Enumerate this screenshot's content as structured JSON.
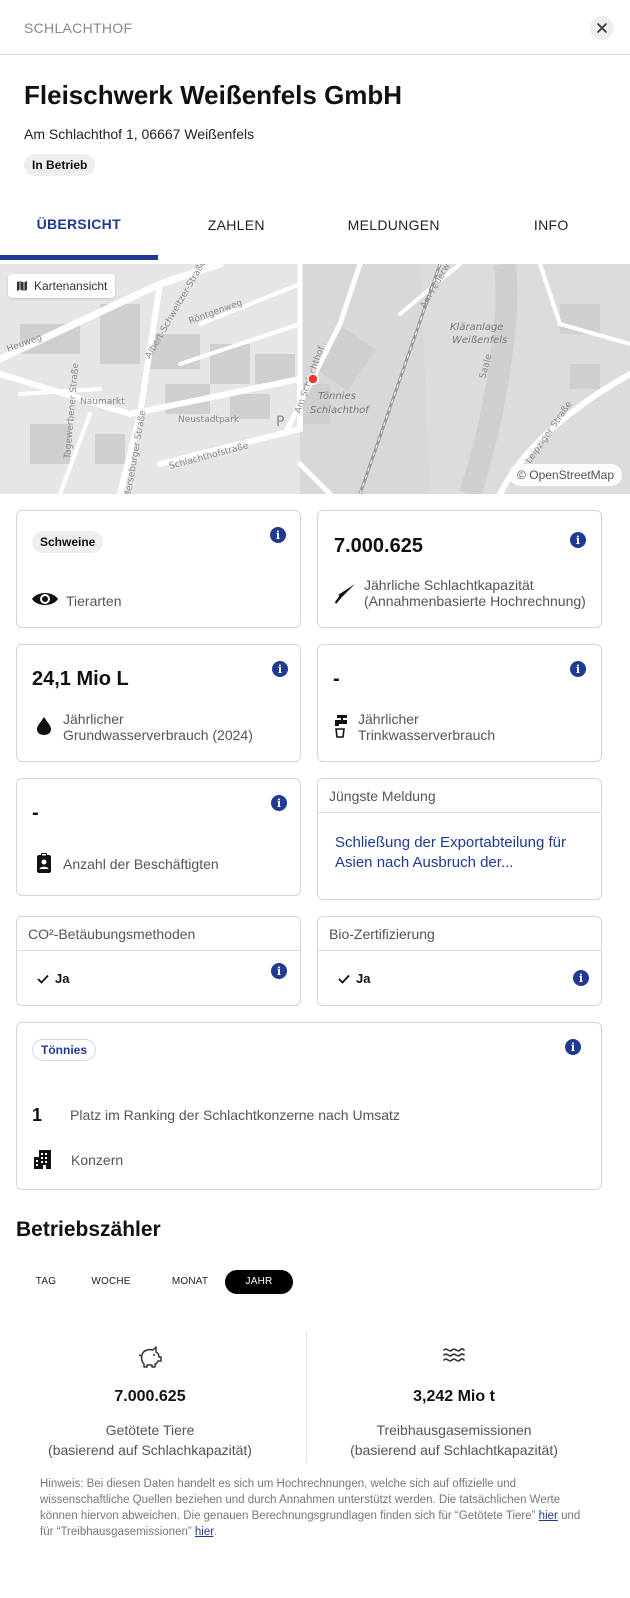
{
  "header": {
    "kicker": "SCHLACHTHOF",
    "title": "Fleischwerk Weißenfels GmbH",
    "address": "Am Schlachthof 1, 06667 Weißenfels",
    "status": "In Betrieb"
  },
  "tabs": [
    {
      "label": "ÜBERSICHT",
      "active": true
    },
    {
      "label": "ZAHLEN",
      "active": false
    },
    {
      "label": "MELDUNGEN",
      "active": false
    },
    {
      "label": "INFO",
      "active": false
    }
  ],
  "map": {
    "view_label": "Kartenansicht",
    "attribution": "© OpenStreetMap",
    "streets": [
      "Heuweg",
      "Tagewerbener Straße",
      "Albert-Schweitzer-Straße",
      "Röntgenweg",
      "Neustadtpark",
      "Naumarkt",
      "Schlachthofstraße",
      "Merseburger Straße",
      "Am Schlachthof",
      "Leipziger Straße",
      "Am Feuerwehr",
      "Saale"
    ],
    "places": [
      "Tönnies Schlachthof",
      "Kläranlage Weißenfels"
    ],
    "parking": "P",
    "marker_color": "#e53935"
  },
  "cards": {
    "species": {
      "value": "Schweine",
      "label": "Tierarten"
    },
    "capacity": {
      "value": "7.000.625",
      "label_line1": "Jährliche Schlachtkapazität",
      "label_line2": "(Annahmenbasierte Hochrechnung)"
    },
    "groundwater": {
      "value": "24,1 Mio L",
      "label_line1": "Jährlicher",
      "label_line2": "Grundwasserverbrauch (2024)"
    },
    "drinkingwater": {
      "value": "-",
      "label_line1": "Jährlicher",
      "label_line2": "Trinkwasserverbrauch"
    },
    "employees": {
      "value": "-",
      "label": "Anzahl der Beschäftigten"
    },
    "latest_news": {
      "heading": "Jüngste Meldung",
      "text": "Schließung der Exportabteilung für Asien nach Ausbruch der..."
    },
    "co2": {
      "heading": "CO²-Betäubungsmethoden",
      "value": "Ja"
    },
    "bio": {
      "heading": "Bio-Zertifizierung",
      "value": "Ja"
    },
    "group": {
      "name": "Tönnies",
      "rank": "1",
      "rank_label": "Platz im Ranking der Schlachtkonzerne nach Umsatz",
      "type_label": "Konzern"
    }
  },
  "counter": {
    "title": "Betriebszähler",
    "periods": [
      {
        "label": "TAG",
        "active": false
      },
      {
        "label": "WOCHE",
        "active": false
      },
      {
        "label": "MONAT",
        "active": false
      },
      {
        "label": "JAHR",
        "active": true
      }
    ],
    "stats": [
      {
        "icon": "pig-icon",
        "value": "7.000.625",
        "label_line1": "Getötete Tiere",
        "label_line2": "(basierend auf Schlachkapazität)"
      },
      {
        "icon": "waves-icon",
        "value": "3,242 Mio t",
        "label_line1": "Treibhausgasemissionen",
        "label_line2": "(basierend auf Schlachtkapazität)"
      }
    ],
    "footnote_text": "Hinweis: Bei diesen Daten handelt es sich um Hochrechnungen, welche sich auf offizielle und wissenschaftliche Quellen beziehen und durch Annahmen unterstützt werden. Die tatsächlichen Werte können hiervon abweichen. Die genauen Berechnungsgrundlagen finden sich für “Getötete Tiere”",
    "footnote_link1": "hier",
    "footnote_mid": "und für “Treibhausgasemissionen”",
    "footnote_link2": "hier",
    "footnote_end": "."
  },
  "colors": {
    "accent": "#1f3a93",
    "marker": "#e53935"
  }
}
